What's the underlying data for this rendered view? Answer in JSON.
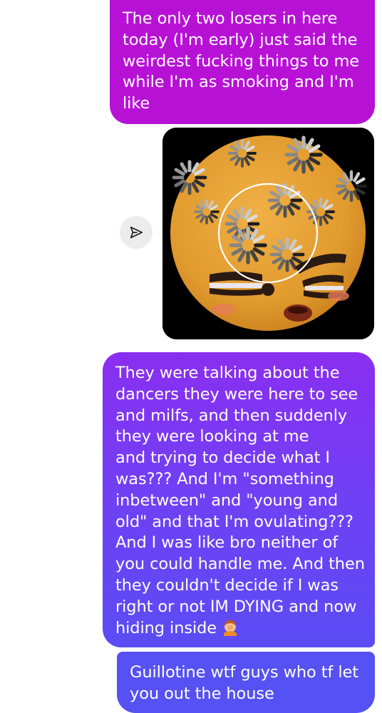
{
  "messages": [
    {
      "id": "m1",
      "lines": [
        "The only two losers in here",
        "today (I'm early) just said the",
        "weirdest fucking things to me",
        "while I'm as smoking and I'm",
        "like"
      ]
    },
    {
      "id": "m2",
      "type": "image",
      "image": "cursed-loading-spinner-face-emoji"
    },
    {
      "id": "m3",
      "lines": [
        "They were talking about the",
        "dancers they were here to see",
        "and milfs, and then suddenly",
        "they were looking at me",
        "and trying to decide what I",
        "was??? And I'm \"something",
        "inbetween\" and \"young and",
        "old\" and that I'm ovulating???",
        "And I was like bro neither of",
        "you could handle me. And then",
        "they couldn't decide if I was",
        "right or not IM DYING and now",
        "hiding inside"
      ],
      "trailing_emoji": "facepalm-emoji"
    },
    {
      "id": "m4",
      "lines": [
        "Guillotine wtf guys who tf let",
        "you out the house"
      ]
    }
  ],
  "share_icon": "send-paper-plane-icon",
  "colors": {
    "bubble_top": "#b811d6",
    "bubble_mid": "#7b3af2",
    "bubble_bottom": "#5651f2",
    "text": "#ffffff",
    "share_bg": "#ececec"
  }
}
